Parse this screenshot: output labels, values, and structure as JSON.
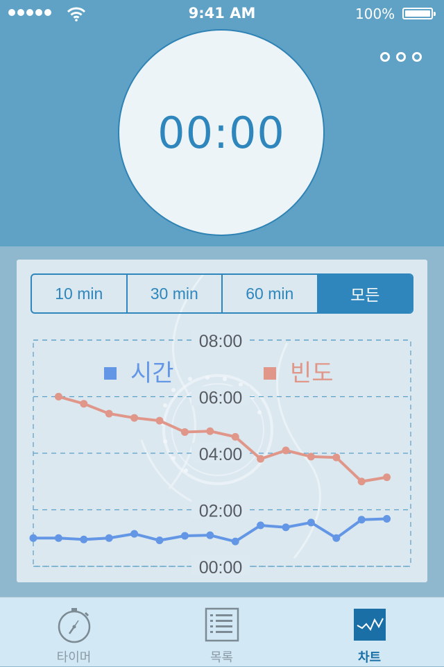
{
  "status_bar": {
    "time": "9:41 AM",
    "battery": "100%",
    "signal_icon": "signal-dots-icon",
    "wifi_icon": "wifi-icon",
    "battery_icon": "battery-icon"
  },
  "header": {
    "more_icon": "more-dots-icon",
    "timer": "00:00"
  },
  "segments": {
    "options": [
      "10 min",
      "30 min",
      "60 min",
      "모든"
    ],
    "selected": "모든"
  },
  "chart_data": {
    "type": "line",
    "y_ticks": [
      "08:00",
      "06:00",
      "04:00",
      "02:00",
      "00:00"
    ],
    "ylim": [
      0,
      8
    ],
    "grid": true,
    "legend_position": "top",
    "series": [
      {
        "name": "시간",
        "color": "#6496e6",
        "values": [
          1.0,
          1.0,
          0.95,
          1.0,
          1.15,
          0.92,
          1.08,
          1.1,
          0.88,
          1.45,
          1.38,
          1.55,
          1.0,
          1.65,
          1.68
        ]
      },
      {
        "name": "빈도",
        "color": "#e0978a",
        "values": [
          6.0,
          5.75,
          5.4,
          5.25,
          5.15,
          4.75,
          4.78,
          4.58,
          3.8,
          4.1,
          3.88,
          3.85,
          3.0,
          3.15
        ]
      }
    ]
  },
  "tab_bar": {
    "tabs": [
      {
        "label": "타이머",
        "icon": "stopwatch-icon",
        "active": false
      },
      {
        "label": "목록",
        "icon": "list-icon",
        "active": false
      },
      {
        "label": "차트",
        "icon": "chart-icon",
        "active": true
      }
    ]
  }
}
